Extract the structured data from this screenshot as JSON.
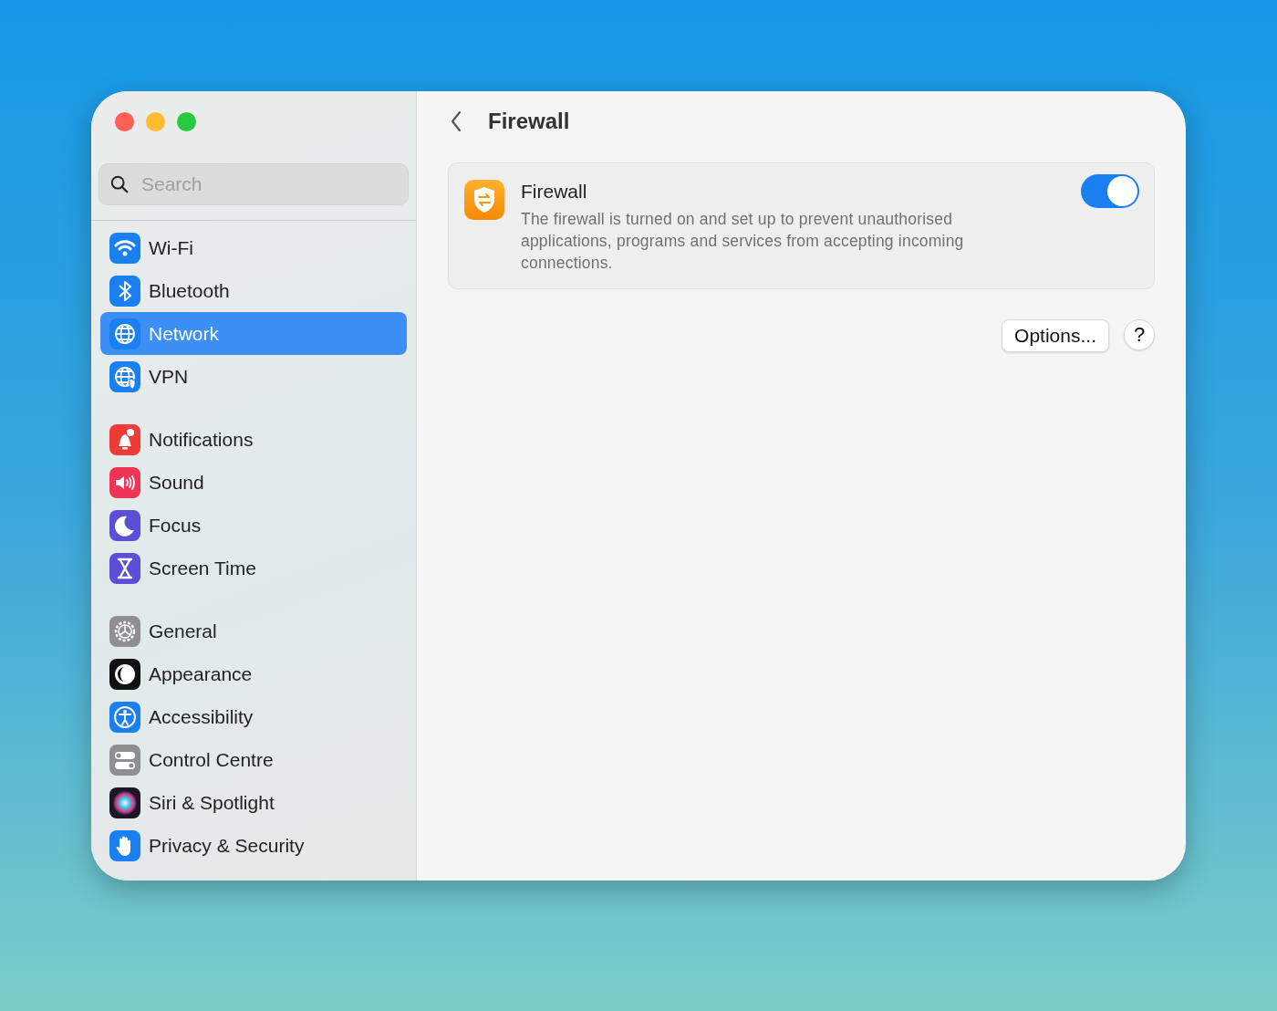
{
  "sidebar": {
    "search": {
      "placeholder": "Search"
    },
    "groups": [
      [
        {
          "label": "Wi-Fi",
          "selected": false
        },
        {
          "label": "Bluetooth",
          "selected": false
        },
        {
          "label": "Network",
          "selected": true
        },
        {
          "label": "VPN",
          "selected": false
        }
      ],
      [
        {
          "label": "Notifications",
          "selected": false
        },
        {
          "label": "Sound",
          "selected": false
        },
        {
          "label": "Focus",
          "selected": false
        },
        {
          "label": "Screen Time",
          "selected": false
        }
      ],
      [
        {
          "label": "General",
          "selected": false
        },
        {
          "label": "Appearance",
          "selected": false
        },
        {
          "label": "Accessibility",
          "selected": false
        },
        {
          "label": "Control Centre",
          "selected": false
        },
        {
          "label": "Siri & Spotlight",
          "selected": false
        },
        {
          "label": "Privacy & Security",
          "selected": false
        }
      ]
    ]
  },
  "header": {
    "title": "Firewall"
  },
  "firewall": {
    "title": "Firewall",
    "description": "The firewall is turned on and set up to prevent unauthorised applications, programs and services from accepting incoming connections.",
    "on": true
  },
  "buttons": {
    "options": "Options...",
    "help": "?"
  }
}
